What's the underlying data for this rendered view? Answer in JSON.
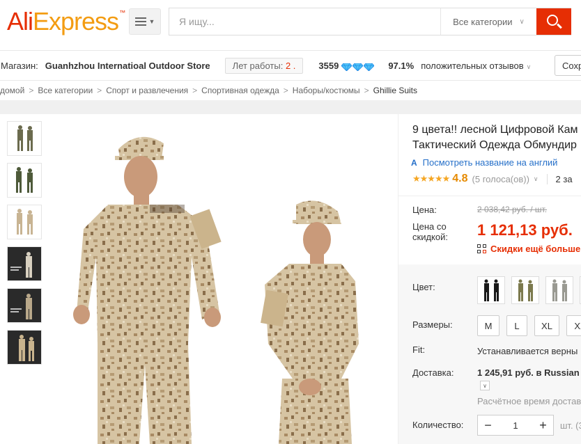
{
  "header": {
    "logo_part1": "Ali",
    "logo_part2": "Express",
    "logo_tm": "™",
    "search_placeholder": "Я ищу...",
    "category_label": "Все категории"
  },
  "store": {
    "label": "Магазин:",
    "name": "Guanhzhou Internatioal Outdoor Store",
    "years_label": "Лет работы:",
    "years_value": "2 .",
    "rank": "3559",
    "positive_pct": "97.1%",
    "feedback_label": "положительных отзывов",
    "save_label": "Сохр"
  },
  "breadcrumb": [
    "домой",
    "Все категории",
    "Спорт и развлечения",
    "Спортивная одежда",
    "Наборы/костюмы",
    "Ghillie Suits"
  ],
  "product": {
    "title_line1": "9 цвета!! лесной Цифровой Кам",
    "title_line2": "Тактический Одежда Обмундир",
    "translate_icon": "A",
    "translate_label": "Посмотреть название на англий",
    "rating_value": "4.8",
    "rating_count": "(5 голоса(ов))",
    "orders": "2 за",
    "price_label": "Цена:",
    "old_price": "2 038,42 руб. / шт.",
    "discount_label_1": "Цена со",
    "discount_label_2": "скидкой:",
    "new_price": "1 121,13 руб.",
    "promo": "Скидки ещё больше"
  },
  "options": {
    "color_label": "Цвет:",
    "size_label": "Размеры:",
    "sizes": [
      "M",
      "L",
      "XL",
      "XX"
    ],
    "fit_label": "Fit:",
    "fit_value": "Устанавливается верны",
    "shipping_label": "Доставка:",
    "shipping_value": "1 245,91 руб. в Russian",
    "estimate": "Расчётное время достав",
    "qty_label": "Количество:",
    "qty_value": "1",
    "qty_minus": "−",
    "qty_plus": "+",
    "qty_unit": "шт. (3"
  },
  "colors": {
    "accent": "#e62e04",
    "logo_orange": "#f39c12",
    "link": "#2670c9",
    "star": "#f5a623"
  }
}
